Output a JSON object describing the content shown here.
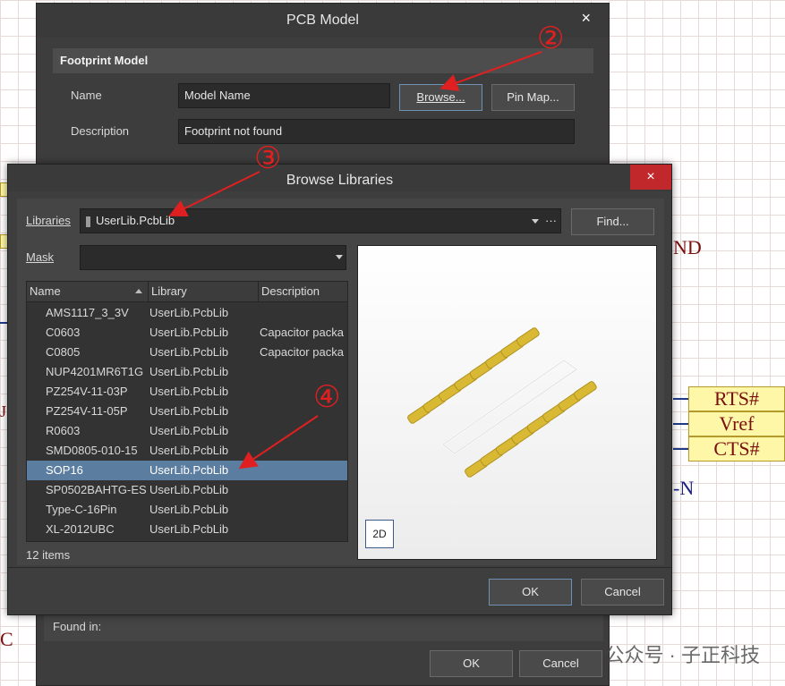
{
  "schematic": {
    "net_labels": [
      "RTS#",
      "Vref",
      "CTS#"
    ],
    "texts": [
      "ND",
      "-N",
      "C",
      "J"
    ]
  },
  "pcb_model": {
    "title": "PCB Model",
    "close": "×",
    "section": "Footprint Model",
    "name_label": "Name",
    "name_value": "Model Name",
    "description_label": "Description",
    "description_value": "Footprint not found",
    "browse_button": "Browse...",
    "pinmap_button": "Pin Map...",
    "found_in_label": "Found in:",
    "ok": "OK",
    "cancel": "Cancel"
  },
  "browse": {
    "title": "Browse Libraries",
    "close": "×",
    "libraries_label": "Libraries",
    "libraries_value": "UserLib.PcbLib",
    "libraries_more": "···",
    "find_button": "Find...",
    "mask_label": "Mask",
    "mask_value": "",
    "columns": [
      "Name",
      "Library",
      "Description"
    ],
    "rows": [
      {
        "name": "AMS1117_3_3V",
        "library": "UserLib.PcbLib",
        "description": ""
      },
      {
        "name": "C0603",
        "library": "UserLib.PcbLib",
        "description": "Capacitor packa"
      },
      {
        "name": "C0805",
        "library": "UserLib.PcbLib",
        "description": "Capacitor packa"
      },
      {
        "name": "NUP4201MR6T1G",
        "library": "UserLib.PcbLib",
        "description": ""
      },
      {
        "name": "PZ254V-11-03P",
        "library": "UserLib.PcbLib",
        "description": ""
      },
      {
        "name": "PZ254V-11-05P",
        "library": "UserLib.PcbLib",
        "description": ""
      },
      {
        "name": "R0603",
        "library": "UserLib.PcbLib",
        "description": ""
      },
      {
        "name": "SMD0805-010-15",
        "library": "UserLib.PcbLib",
        "description": ""
      },
      {
        "name": "SOP16",
        "library": "UserLib.PcbLib",
        "description": ""
      },
      {
        "name": "SP0502BAHTG-ES",
        "library": "UserLib.PcbLib",
        "description": ""
      },
      {
        "name": "Type-C-16Pin",
        "library": "UserLib.PcbLib",
        "description": ""
      },
      {
        "name": "XL-2012UBC",
        "library": "UserLib.PcbLib",
        "description": ""
      }
    ],
    "selected_row": "SOP16",
    "item_count": "12 items",
    "view_2d": "2D",
    "ok": "OK",
    "cancel": "Cancel"
  },
  "annotations": [
    "②",
    "③",
    "④"
  ],
  "watermark": "公众号 · 子正科技",
  "colors": {
    "accent_red": "#e02020",
    "selection": "#5b7da0",
    "pad_gold": "#d9b934"
  }
}
